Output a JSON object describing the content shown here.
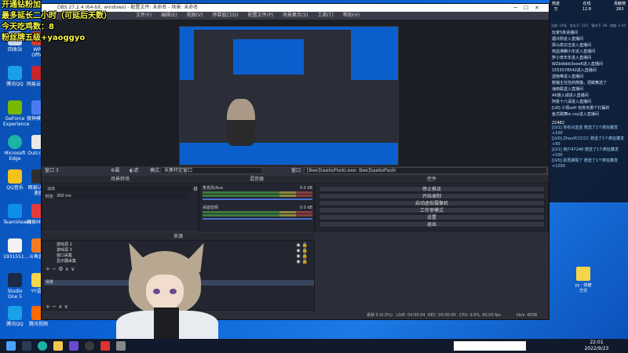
{
  "overlay": {
    "line1": "开通钻粉加",
    "line2": "最多延长二小时（可延后天数）",
    "line3": "今天吃鸡数：8",
    "line4": "粉丝牌五级+yaoggyo"
  },
  "obs": {
    "title": "OBS 27.2.4 (64-bit, windows) - 配置文件: 未命名 - 场景: 未命名",
    "menu": [
      "文件(F)",
      "编辑(E)",
      "视图(V)",
      "停靠窗口(D)",
      "配置文件(P)",
      "场景集合(S)",
      "工具(T)",
      "帮助(H)"
    ],
    "toolbar": {
      "no_source": "窗口 3",
      "properties": "属性",
      "filters": "滤镜",
      "mode_label": "模式",
      "mode_value": "采集特定窗口",
      "window_label": "窗口",
      "window_value": "[Bee]SaekoPsoki.exe: Bee]SaekoPsoki"
    },
    "docks": {
      "scenes": "场景转场",
      "mixer": "混音器",
      "controls": "控件",
      "sources": "来源"
    },
    "scene_items": [
      "淡出",
      "时长"
    ],
    "scene_duration": "300 ms",
    "mixer": [
      {
        "label": "麦克风/Aux",
        "db": "0.0 dB"
      },
      {
        "label": "桌面音频",
        "db": "0.0 dB"
      }
    ],
    "controls": [
      "停止推流",
      "开始录制",
      "启动虚拟摄像机",
      "工作室模式",
      "设置",
      "退出"
    ],
    "sources": [
      "游戏源 2",
      "游戏源 3",
      "窗口采集",
      "显示器采集",
      "场景"
    ],
    "status": {
      "dropped": "丢帧 0 (0.0%)",
      "live": "LIVE: 04:50:04",
      "rec": "REC: 00:00:00",
      "cpu": "CPU: 9.6%, 60.00 fps",
      "kbps": "kb/s: 8036"
    }
  },
  "chat": {
    "stats": [
      {
        "label": "热度",
        "value": "万"
      },
      {
        "label": "在线",
        "value": "12.8"
      },
      {
        "label": "贡献榜",
        "value": "283"
      }
    ],
    "stats2": [
      "当前: 14场",
      "金瓜子: 3.01",
      "银瓜子: 38",
      "热度: 1.4千"
    ],
    "messages": [
      "玩家5条进播间",
      "烟冷熙进入直播间",
      "梁山意识玉进入直播间",
      "热血沸腾小年进入直播间",
      "梦小奇年年进入直播间",
      "WZbdbbb3eee6进入直播间",
      "1553578542进入直播间",
      "送她唯进入直播间",
      "赠播主任性的熊猫，把跳舞送了",
      "海南联送入直播间",
      "AK猴入城进入直播间",
      "阿俊十六请进入直播间",
      "[U0] 小情sofr 玩你天那个打赢的",
      "鱼式跳舞le coy进入直播间"
    ],
    "count": "22482",
    "gifts": [
      "[LV1] 你有点蓝蓝 赠送了1个疯狂藏发 +100",
      "[LV0] ZhouYCCCCC 赠送了1个疯狂藏发 +50",
      "[LV1] 用户47248 赠送了1个疯狂藏发 +100",
      "[LV0] 别再撕裂了 赠送了1个疯狂藏发 +1200"
    ]
  },
  "desktop_icons": [
    "回收站",
    "WPS Office",
    "腾讯QQ",
    "网易云音乐",
    "GeForce Experience",
    "夜神模拟器",
    "Microsoft Edge",
    "Outcome",
    "QQ音乐",
    "网易UU加速器",
    "TeamViewer",
    "网易MuMu",
    "1931551...",
    "斗鱼直播",
    "Studio One 5",
    "YY语音",
    "腾讯QQ",
    "腾讯视频"
  ],
  "right_icon": "yy - 快捷方式",
  "taskbar": {
    "time": "22:01",
    "date": "2022/9/23"
  }
}
